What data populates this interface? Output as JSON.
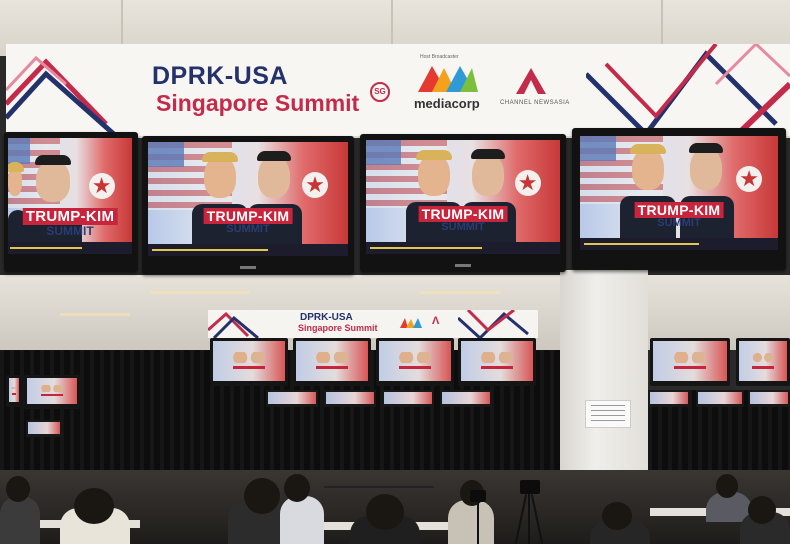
{
  "banner": {
    "title": "DPRK-USA",
    "subtitle": "Singapore Summit",
    "badge": "SG",
    "host_small": "Host Broadcaster",
    "host_logo_text": "mediacorp",
    "channel_logo_text": "CHANNEL NEWSASIA"
  },
  "screens": [
    {
      "caption": "TRUMP-KIM",
      "caption_sub": "SUMMIT"
    },
    {
      "caption": "TRUMP-KIM",
      "caption_sub": "SUMMIT"
    },
    {
      "caption": "TRUMP-KIM",
      "caption_sub": "SUMMIT"
    },
    {
      "caption": "TRUMP-KIM",
      "caption_sub": "SUMMIT"
    }
  ],
  "banner2": {
    "title": "DPRK-USA",
    "subtitle": "Singapore Summit"
  },
  "colors": {
    "navy": "#24326b",
    "red": "#c42a4a",
    "caption_red": "#c8243c"
  }
}
